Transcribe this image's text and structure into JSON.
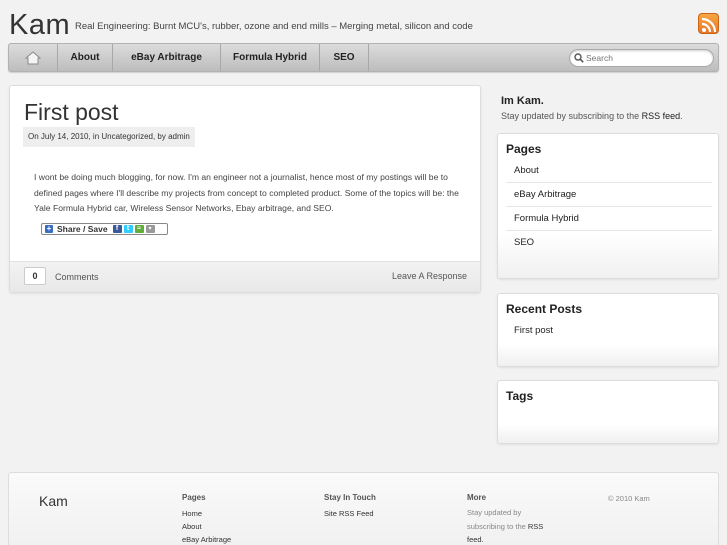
{
  "header": {
    "title": "Kam",
    "description": "Real Engineering: Burnt MCU's, rubber, ozone and end mills – Merging metal, silicon and code",
    "rss_icon": "rss-icon"
  },
  "nav": {
    "home_icon": "home-icon",
    "items": [
      {
        "label": "About"
      },
      {
        "label": "eBay Arbitrage"
      },
      {
        "label": "Formula Hybrid"
      },
      {
        "label": "SEO"
      }
    ],
    "search_placeholder": "Search"
  },
  "post": {
    "title": "First post",
    "meta": "On July 14, 2010, in Uncategorized, by admin",
    "body": "I wont be doing much blogging, for now. I'm an engineer not a journalist, hence most of my postings will be to defined pages where I'll describe my projects from concept to completed product. Some of the topics will be: the Yale Formula Hybrid car, Wireless Sensor Networks, Ebay arbitrage, and SEO.",
    "share_label": "Share / Save",
    "comment_count": "0",
    "comments_label": "Comments",
    "leave_response": "Leave A Response"
  },
  "sidebar": {
    "about_title": "Im Kam.",
    "about_text": "Stay updated by subscribing to the",
    "about_rss": "RSS feed",
    "about_end": ".",
    "pages_title": "Pages",
    "pages": [
      {
        "label": "About"
      },
      {
        "label": "eBay Arbitrage"
      },
      {
        "label": "Formula Hybrid"
      },
      {
        "label": "SEO"
      }
    ],
    "recent_title": "Recent Posts",
    "recent": [
      {
        "label": "First post"
      }
    ],
    "tags_title": "Tags"
  },
  "footer": {
    "logo": "Kam",
    "pages_head": "Pages",
    "pages": [
      {
        "label": "Home"
      },
      {
        "label": "About"
      },
      {
        "label": "eBay Arbitrage"
      }
    ],
    "touch_head": "Stay In Touch",
    "touch_link": "Site RSS Feed",
    "more_head": "More",
    "more_line1": "Stay updated by",
    "more_line2": "subscribing to the",
    "more_rss": "RSS",
    "more_line3": "feed.",
    "copyright": "© 2010 Kam"
  }
}
